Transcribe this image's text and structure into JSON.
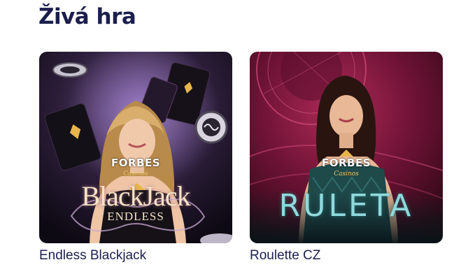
{
  "section": {
    "title": "Živá hra"
  },
  "games": [
    {
      "name": "Endless Blackjack",
      "brand": "FORBES",
      "brand_sub": "Casinos",
      "art_title": "BlackJack",
      "art_subtitle": "ENDLESS"
    },
    {
      "name": "Roulette CZ",
      "brand": "FORBES",
      "brand_sub": "Casinos",
      "art_title": "RULETA"
    }
  ]
}
